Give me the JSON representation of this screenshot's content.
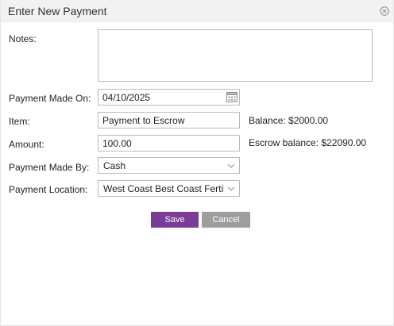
{
  "dialog": {
    "title": "Enter New Payment"
  },
  "form": {
    "notes": {
      "label": "Notes:",
      "value": ""
    },
    "payment_made_on": {
      "label": "Payment Made On:",
      "value": "04/10/2025"
    },
    "item": {
      "label": "Item:",
      "value": "Payment to Escrow"
    },
    "amount": {
      "label": "Amount:",
      "value": "100.00"
    },
    "payment_made_by": {
      "label": "Payment Made By:",
      "value": "Cash"
    },
    "payment_location": {
      "label": "Payment Location:",
      "value": "West Coast Best Coast Fertility"
    }
  },
  "info": {
    "balance": "Balance: $2000.00",
    "escrow_balance": "Escrow balance: $22090.00"
  },
  "buttons": {
    "save": "Save",
    "cancel": "Cancel"
  },
  "colors": {
    "save_button": "#7a3d96",
    "cancel_button": "#9e9e9e",
    "titlebar": "#f2f2f2"
  },
  "icons": {
    "close": "close-circle-icon",
    "calendar": "calendar-icon",
    "dropdown": "chevron-down-icon"
  }
}
